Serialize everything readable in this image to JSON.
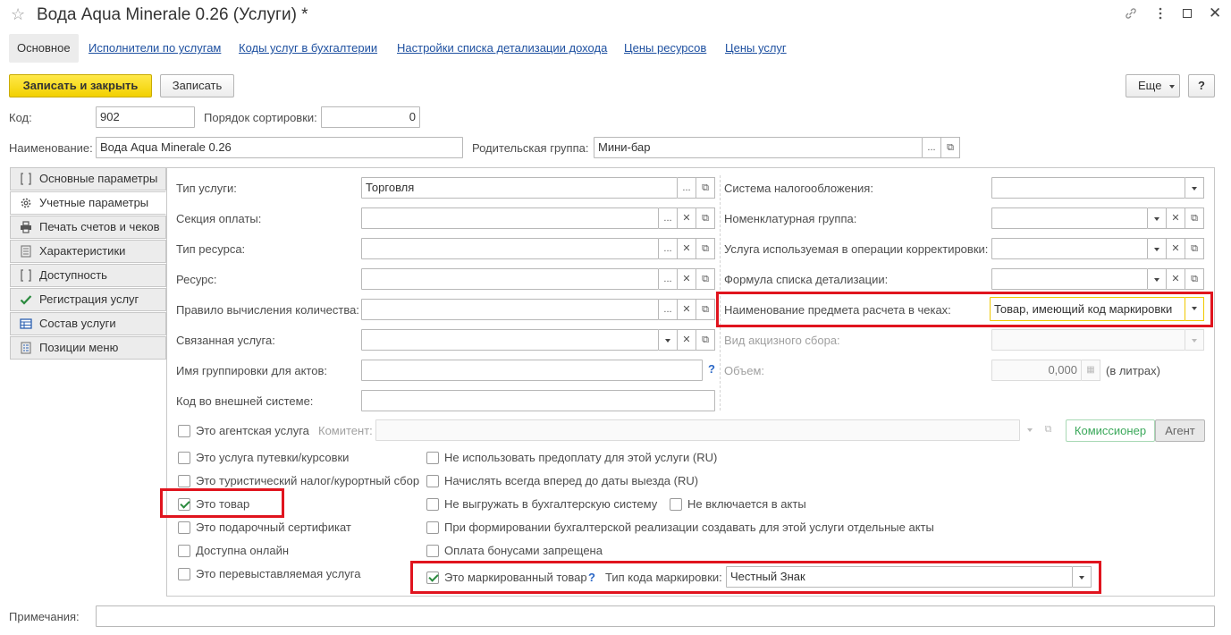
{
  "window": {
    "title": "Вода Aqua Minerale 0.26 (Услуги) *"
  },
  "top_tabs": [
    {
      "label": "Основное"
    },
    {
      "label": "Исполнители по услугам"
    },
    {
      "label": "Коды услуг в бухгалтерии"
    },
    {
      "label": "Настройки списка детализации дохода"
    },
    {
      "label": "Цены ресурсов"
    },
    {
      "label": "Цены услуг"
    }
  ],
  "toolbar": {
    "save_close": "Записать и закрыть",
    "save": "Записать",
    "more": "Еще",
    "help": "?"
  },
  "header": {
    "code_label": "Код:",
    "code_value": "902",
    "sort_label": "Порядок сортировки:",
    "sort_value": "0",
    "name_label": "Наименование:",
    "name_value": "Вода Aqua Minerale 0.26",
    "parent_label": "Родительская группа:",
    "parent_value": "Мини-бар"
  },
  "side_tabs": [
    {
      "label": "Основные параметры",
      "icon": "brackets-icon"
    },
    {
      "label": "Учетные параметры",
      "icon": "gear-icon"
    },
    {
      "label": "Печать счетов и чеков",
      "icon": "printer-icon"
    },
    {
      "label": "Характеристики",
      "icon": "list-icon"
    },
    {
      "label": "Доступность",
      "icon": "brackets-icon"
    },
    {
      "label": "Регистрация услуг",
      "icon": "checkmark-icon"
    },
    {
      "label": "Состав услуги",
      "icon": "table-icon"
    },
    {
      "label": "Позиции меню",
      "icon": "menu-icon"
    }
  ],
  "left_fields": {
    "service_type": {
      "label": "Тип услуги:",
      "value": "Торговля"
    },
    "payment_section": {
      "label": "Секция оплаты:",
      "value": ""
    },
    "resource_type": {
      "label": "Тип ресурса:",
      "value": ""
    },
    "resource": {
      "label": "Ресурс:",
      "value": ""
    },
    "quantity_rule": {
      "label": "Правило вычисления количества:",
      "value": ""
    },
    "linked_service": {
      "label": "Связанная услуга:",
      "value": ""
    },
    "grouping_name": {
      "label": "Имя группировки для актов:",
      "value": ""
    },
    "external_code": {
      "label": "Код во внешней системе:",
      "value": ""
    }
  },
  "right_fields": {
    "tax_system": {
      "label": "Система налогообложения:",
      "value": ""
    },
    "nomenclature_group": {
      "label": "Номенклатурная группа:",
      "value": ""
    },
    "correction_service": {
      "label": "Услуга используемая в операции корректировки:",
      "value": ""
    },
    "detail_formula": {
      "label": "Формула списка детализации:",
      "value": ""
    },
    "receipt_subject": {
      "label": "Наименование предмета расчета в чеках:",
      "value": "Товар, имеющий код маркировки"
    },
    "excise_type": {
      "label": "Вид акцизного сбора:",
      "value": ""
    },
    "volume": {
      "label": "Объем:",
      "value": "0,000",
      "unit": "(в литрах)"
    }
  },
  "agent": {
    "label": "Это агентская услуга",
    "checked": false,
    "committent_label": "Комитент:",
    "committent_value": "",
    "btn_commissioner": "Комиссионер",
    "btn_agent": "Агент"
  },
  "checkboxes_left": [
    {
      "label": "Это услуга путевки/курсовки",
      "checked": false
    },
    {
      "label": "Это туристический налог/курортный сбор",
      "checked": false
    },
    {
      "label": "Это товар",
      "checked": true
    },
    {
      "label": "Это подарочный сертификат",
      "checked": false
    },
    {
      "label": "Доступна онлайн",
      "checked": false
    },
    {
      "label": "Это перевыставляемая услуга",
      "checked": false
    }
  ],
  "checkboxes_right": [
    {
      "label": "Не использовать предоплату для этой услуги (RU)",
      "checked": false
    },
    {
      "label": "Начислять всегда вперед до даты выезда (RU)",
      "checked": false
    },
    {
      "label": "Не выгружать в бухгалтерскую систему",
      "checked": false
    },
    {
      "label": "Не включается в акты",
      "checked": false
    },
    {
      "label": "При формировании бухгалтерской реализации создавать для этой услуги отдельные акты",
      "checked": false
    },
    {
      "label": "Оплата бонусами запрещена",
      "checked": false
    }
  ],
  "marking": {
    "label": "Это маркированный товар",
    "checked": true,
    "help": "?",
    "type_label": "Тип кода маркировки:",
    "type_value": "Честный Знак"
  },
  "grouping_help": "?",
  "notes": {
    "label": "Примечания:",
    "value": ""
  },
  "colors": {
    "accent_yellow": "#f5d800",
    "highlight_red": "#e0141e",
    "link_blue": "#1e50a0"
  }
}
